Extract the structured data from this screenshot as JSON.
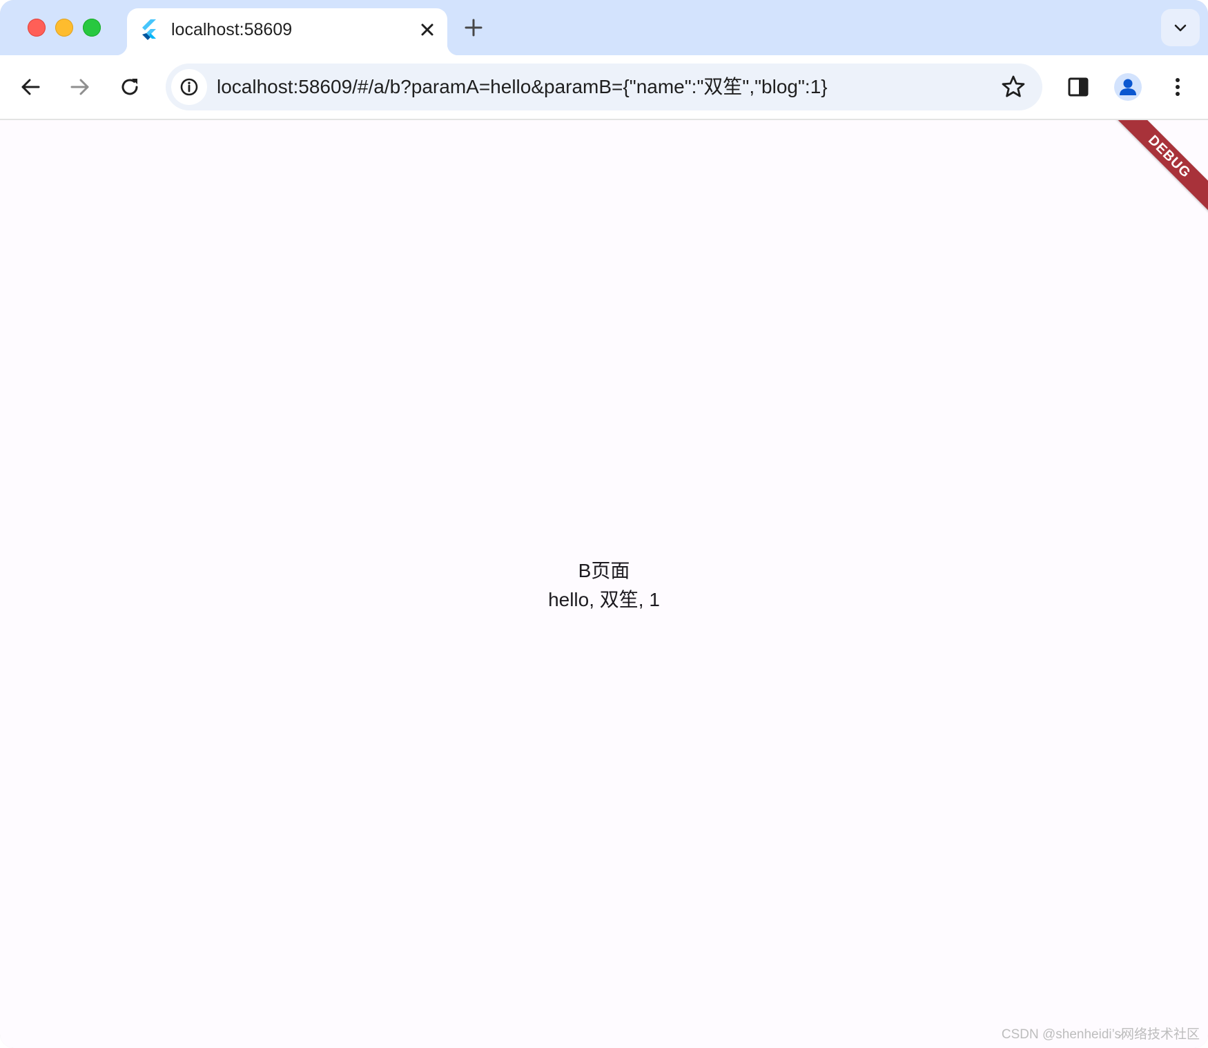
{
  "tab": {
    "title": "localhost:58609",
    "favicon": "flutter-icon"
  },
  "toolbar": {
    "url": "localhost:58609/#/a/b?paramA=hello&paramB={\"name\":\"双笙\",\"blog\":1}",
    "back_icon": "arrow-left-icon",
    "forward_icon": "arrow-right-icon",
    "reload_icon": "reload-icon",
    "site_info_icon": "info-icon",
    "bookmark_icon": "star-icon",
    "side_panel_icon": "side-panel-icon",
    "profile_icon": "person-icon",
    "menu_icon": "kebab-menu-icon"
  },
  "content": {
    "title": "B页面",
    "params_line": "hello, 双笙, 1",
    "debug_banner": "DEBUG",
    "watermark": "CSDN @shenheidi’s̷网络技术社区"
  },
  "colors": {
    "tabstrip": "#d3e3fd",
    "omnibox": "#edf2fa",
    "content_bg": "#fefbff",
    "debug_banner": "#a8323a",
    "profile_blue": "#0b57d0"
  }
}
